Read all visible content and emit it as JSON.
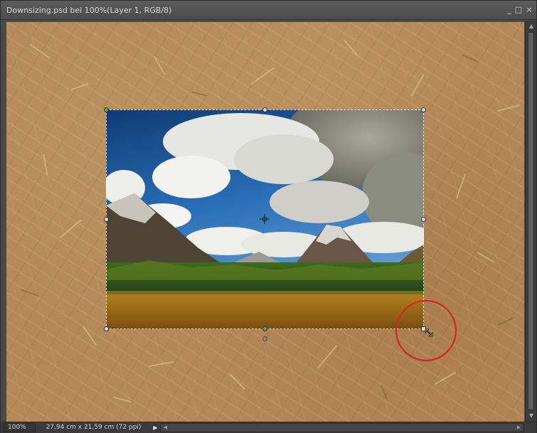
{
  "window": {
    "title": "Downsizing.psd bei 100%(Layer 1, RGB/8)",
    "minimize_icon": "minimize-icon",
    "maximize_icon": "maximize-icon",
    "close_icon": "close-icon"
  },
  "status": {
    "zoom": "100%",
    "doc_size": "27,94 cm x 21,59 cm (72 ppi)",
    "menu_icon": "triangle-right-icon"
  },
  "annotation": {
    "highlight_color": "#d6252a",
    "highlight_target": "bottom-right-transform-handle"
  },
  "layer": {
    "name": "Layer 1",
    "image_subject": "mountain landscape photo"
  }
}
